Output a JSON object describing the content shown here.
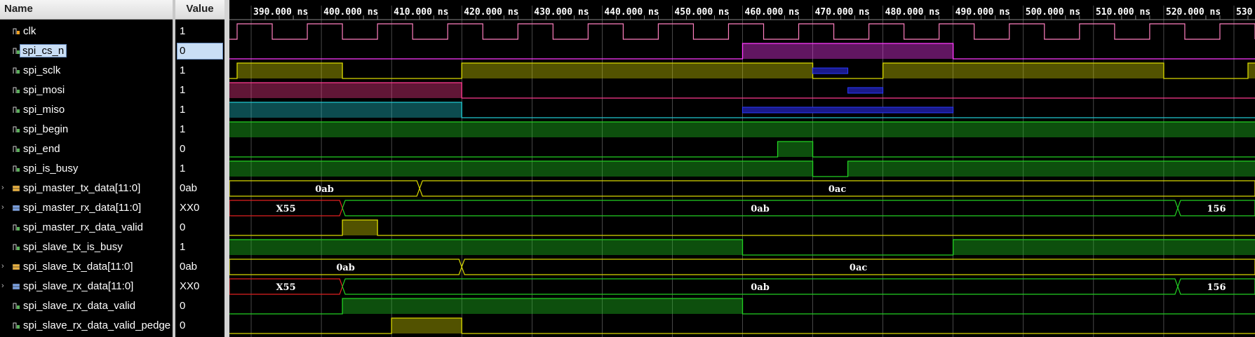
{
  "headers": {
    "name": "Name",
    "value": "Value"
  },
  "time_axis": {
    "unit": "ns",
    "ticks": [
      "390.000 ns",
      "400.000 ns",
      "410.000 ns",
      "420.000 ns",
      "430.000 ns",
      "440.000 ns",
      "450.000 ns",
      "460.000 ns",
      "470.000 ns",
      "480.000 ns",
      "490.000 ns",
      "500.000 ns",
      "510.000 ns",
      "520.000 ns",
      "530"
    ],
    "tick_values": [
      390,
      400,
      410,
      420,
      430,
      440,
      450,
      460,
      470,
      480,
      490,
      500,
      510,
      520,
      530
    ],
    "range": [
      386.9,
      533.0
    ]
  },
  "colors": {
    "clk": "#ff7fbf",
    "cs": "#ff3bff",
    "yellow": "#d8d800",
    "magenta": "#ff3b8f",
    "cyan": "#20c8d0",
    "green": "#22d022",
    "navy": "#2a3aff",
    "red": "#e02020",
    "white": "#ffffff"
  },
  "signals": [
    {
      "name": "clk",
      "value": "1",
      "icon": "bit-signal-icon",
      "expandable": false,
      "type": "clock",
      "color": "clk",
      "period": 10,
      "first_rise": 388,
      "high_time": 5
    },
    {
      "name": "spi_cs_n",
      "value": "0",
      "icon": "bit-signal-icon",
      "expandable": false,
      "selected": true,
      "type": "bit",
      "color": "cs",
      "initial": 0,
      "transitions": [
        460,
        490
      ],
      "fill_high": true
    },
    {
      "name": "spi_sclk",
      "value": "1",
      "icon": "bit-signal-icon",
      "expandable": false,
      "type": "bit",
      "color": "yellow",
      "initial": 0,
      "transitions": [
        388,
        403,
        420,
        470,
        480,
        520,
        532
      ],
      "fill_high": true,
      "low_overlays": [
        [
          470,
          475
        ]
      ]
    },
    {
      "name": "spi_mosi",
      "value": "1",
      "icon": "bit-signal-icon",
      "expandable": false,
      "type": "bit",
      "color": "magenta",
      "initial": 1,
      "transitions": [
        420
      ],
      "fill_high": true,
      "high_overlays": [
        [
          475,
          480
        ]
      ]
    },
    {
      "name": "spi_miso",
      "value": "1",
      "icon": "bit-signal-icon",
      "expandable": false,
      "type": "bit",
      "color": "cyan",
      "initial": 1,
      "transitions": [
        420
      ],
      "fill_high": true,
      "low_overlays": [
        [
          460,
          490
        ]
      ]
    },
    {
      "name": "spi_begin",
      "value": "1",
      "icon": "bit-signal-icon",
      "expandable": false,
      "type": "bit",
      "color": "green",
      "initial": 1,
      "transitions": [],
      "fill_high": true
    },
    {
      "name": "spi_end",
      "value": "0",
      "icon": "bit-signal-icon",
      "expandable": false,
      "type": "bit",
      "color": "green",
      "initial": 0,
      "transitions": [
        465,
        470
      ],
      "fill_high": true
    },
    {
      "name": "spi_is_busy",
      "value": "1",
      "icon": "bit-signal-icon",
      "expandable": false,
      "type": "bit",
      "color": "green",
      "initial": 1,
      "transitions": [
        470,
        475
      ],
      "fill_high": true
    },
    {
      "name": "spi_master_tx_data[11:0]",
      "value": "0ab",
      "icon": "bus-signal-icon",
      "expandable": true,
      "type": "bus",
      "color": "yellow",
      "segments": [
        {
          "end": 414,
          "label": "0ab"
        },
        {
          "end": 534,
          "label": "0ac"
        }
      ]
    },
    {
      "name": "spi_master_rx_data[11:0]",
      "value": "XX0",
      "icon": "bus-signal-icon",
      "expandable": true,
      "type": "bus",
      "color": "green",
      "segments": [
        {
          "end": 403,
          "label": "X55",
          "color": "red"
        },
        {
          "end": 522,
          "label": "0ab"
        },
        {
          "end": 534,
          "label": "156"
        }
      ]
    },
    {
      "name": "spi_master_rx_data_valid",
      "value": "0",
      "icon": "bit-signal-icon",
      "expandable": false,
      "type": "bit",
      "color": "yellow",
      "initial": 0,
      "transitions": [
        403,
        408
      ],
      "fill_high": true
    },
    {
      "name": "spi_slave_tx_is_busy",
      "value": "1",
      "icon": "bit-signal-icon",
      "expandable": false,
      "type": "bit",
      "color": "green",
      "initial": 1,
      "transitions": [
        460,
        490
      ],
      "fill_high": true
    },
    {
      "name": "spi_slave_tx_data[11:0]",
      "value": "0ab",
      "icon": "bus-signal-icon",
      "expandable": true,
      "type": "bus",
      "color": "yellow",
      "segments": [
        {
          "end": 420,
          "label": "0ab"
        },
        {
          "end": 534,
          "label": "0ac"
        }
      ]
    },
    {
      "name": "spi_slave_rx_data[11:0]",
      "value": "XX0",
      "icon": "bus-signal-icon",
      "expandable": true,
      "type": "bus",
      "color": "green",
      "segments": [
        {
          "end": 403,
          "label": "X55",
          "color": "red"
        },
        {
          "end": 522,
          "label": "0ab"
        },
        {
          "end": 534,
          "label": "156"
        }
      ]
    },
    {
      "name": "spi_slave_rx_data_valid",
      "value": "0",
      "icon": "bit-signal-icon",
      "expandable": false,
      "type": "bit",
      "color": "green",
      "initial": 0,
      "transitions": [
        403,
        460
      ],
      "fill_high": true
    },
    {
      "name": "spi_slave_rx_data_valid_pedge",
      "value": "0",
      "icon": "bit-signal-icon",
      "expandable": false,
      "type": "bit",
      "color": "yellow",
      "initial": 0,
      "transitions": [
        410,
        420
      ],
      "fill_high": true
    }
  ]
}
